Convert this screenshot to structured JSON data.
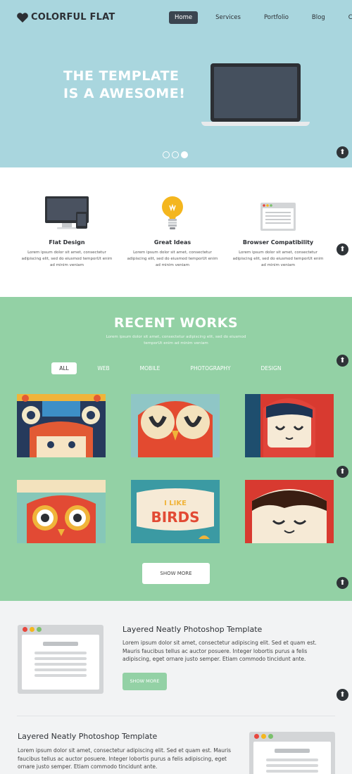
{
  "header": {
    "logo_text": "COLORFUL FLAT",
    "nav": [
      "Home",
      "Services",
      "Portfolio",
      "Blog",
      "Contact"
    ]
  },
  "hero": {
    "title_line1": "THE TEMPLATE",
    "title_line2": "IS A AWESOME!",
    "slide_count": 3,
    "active_slide": 3
  },
  "features": [
    {
      "title": "Flat Design",
      "text": "Lorem ipsum dolor sit amet, consectetur adipiscing elit, sed do eiusmod temporUt enim ad minim veniam",
      "icon": "computer-devices-icon"
    },
    {
      "title": "Great Ideas",
      "text": "Lorem ipsum dolor sit amet, consectetur adipiscing elit, sed do eiusmod temporUt enim ad minim veniam",
      "icon": "lightbulb-icon"
    },
    {
      "title": "Browser Compatibility",
      "text": "Lorem ipsum dolor sit amet, consectetur adipiscing elit, sed do eiusmod temporUt enim ad minim veniam",
      "icon": "browser-window-icon"
    }
  ],
  "works": {
    "title": "RECENT WORKS",
    "subtitle": "Lorem ipsum dolor sit amet, consectetur adipiscing elit, sed do eiusmod temporUt enim ad minim veniam",
    "filters": [
      "ALL",
      "WEB",
      "MOBILE",
      "PHOTOGRAPHY",
      "DESIGN"
    ],
    "active_filter": "ALL",
    "thumbs": [
      "monster-illustration",
      "owl-illustration",
      "red-hood-boy-illustration",
      "orange-owl-illustration",
      "i-like-birds-illustration",
      "smiling-face-illustration"
    ],
    "thumb_text": "I LIKE BIRDS",
    "show_more": "SHOW MORE"
  },
  "blocks": [
    {
      "title": "Layered Neatly Photoshop Template",
      "text": "Lorem ipsum dolor sit amet, consectetur adipiscing elit. Sed et quam est. Mauris faucibus tellus ac auctor posuere. Integer lobortis purus a felis adipiscing, eget ornare justo semper. Etiam commodo tincidunt ante.",
      "button": "SHOW MORE"
    },
    {
      "title": "Layered Neatly Photoshop Template",
      "text": "Lorem ipsum dolor sit amet, consectetur adipiscing elit. Sed et quam est. Mauris faucibus tellus ac auctor posuere. Integer lobortis purus a felis adipiscing, eget ornare justo semper. Etiam commodo tincidunt ante."
    }
  ],
  "colors": {
    "hero_bg": "#a9d6de",
    "works_bg": "#93d1a5",
    "dark": "#2c2f34",
    "bottom_bg": "#f2f3f4"
  },
  "icons": {
    "scroll_top": "arrow-up-icon"
  }
}
